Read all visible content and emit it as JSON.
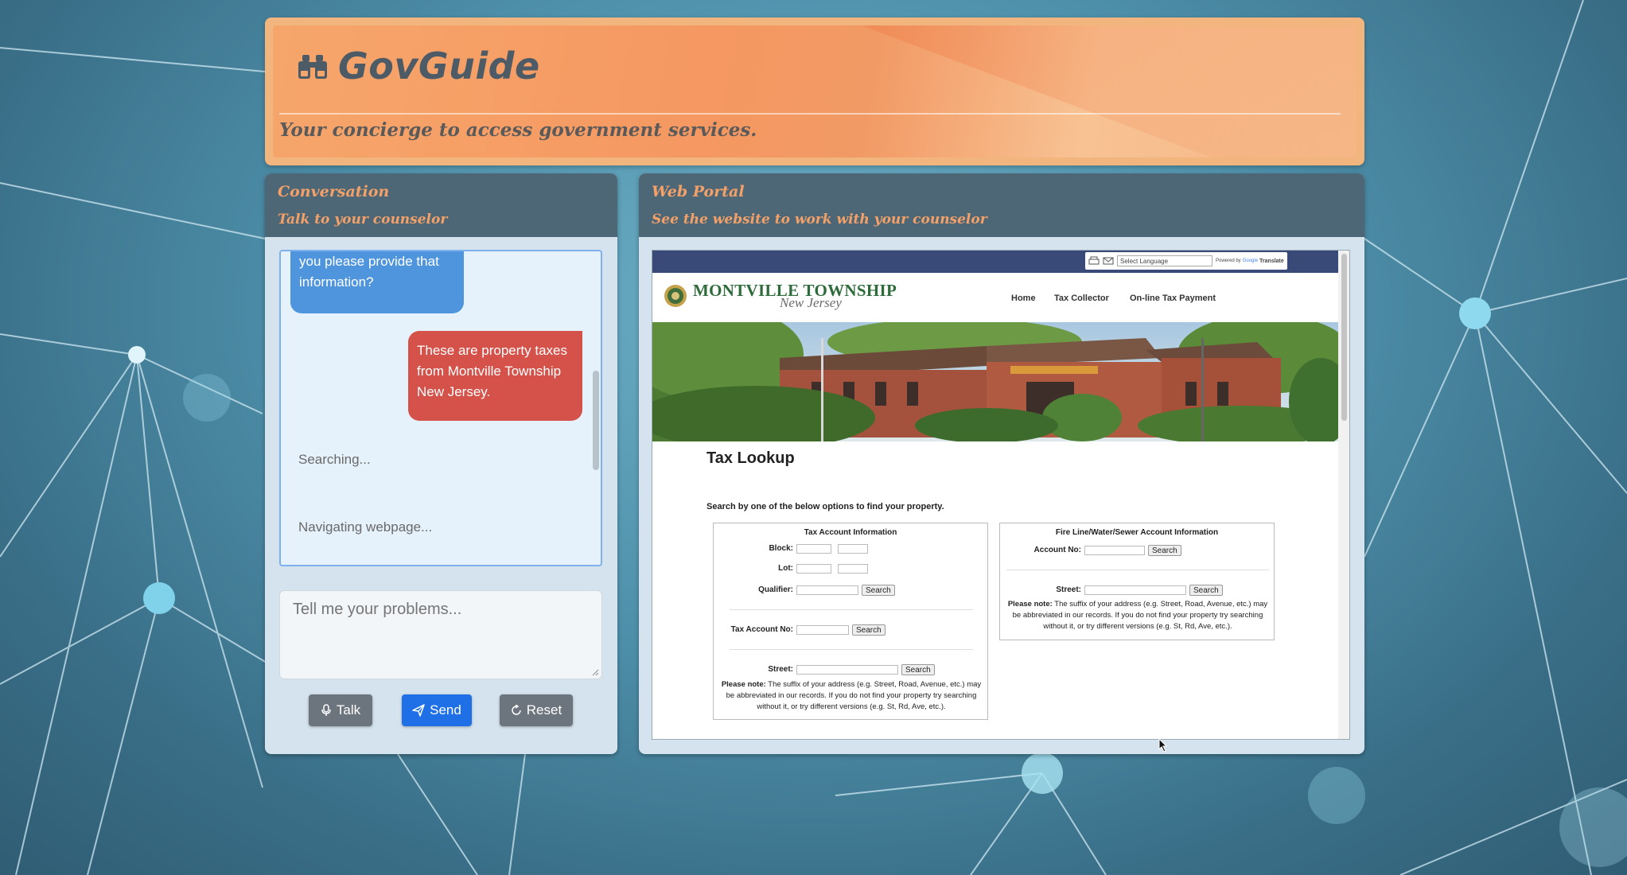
{
  "header": {
    "title": "GovGuide",
    "tagline": "Your concierge to access government services."
  },
  "conversation": {
    "title": "Conversation",
    "subtitle": "Talk to your counselor",
    "messages": [
      {
        "role": "bot",
        "text": "you please provide that information?"
      },
      {
        "role": "user",
        "text": "These are property taxes from Montville Township New Jersey."
      }
    ],
    "status": [
      "Searching...",
      "Navigating webpage..."
    ],
    "input_placeholder": "Tell me your problems...",
    "buttons": {
      "talk": "Talk",
      "send": "Send",
      "reset": "Reset"
    }
  },
  "web_portal": {
    "title": "Web Portal",
    "subtitle": "See the website to work with your counselor",
    "site": {
      "translate_select": "Select Language",
      "translate_powered": "Powered by",
      "translate_google": "Google",
      "translate_word": "Translate",
      "name": "MONTVILLE TOWNSHIP",
      "name_sub": "New Jersey",
      "nav": [
        "Home",
        "Tax Collector",
        "On-line Tax Payment"
      ],
      "page_title": "Tax Lookup",
      "instruction": "Search by one of the below options to find your property.",
      "tax_box": {
        "title": "Tax Account Information",
        "block_label": "Block:",
        "lot_label": "Lot:",
        "qualifier_label": "Qualifier:",
        "account_label": "Tax Account No:",
        "street_label": "Street:",
        "search": "Search",
        "note_bold": "Please note:",
        "note": "The suffix of your address (e.g. Street, Road, Avenue, etc.) may be abbreviated in our records. If you do not find your property try searching without it, or try different versions (e.g. St, Rd, Ave, etc.)."
      },
      "fire_box": {
        "title": "Fire Line/Water/Sewer Account Information",
        "account_label": "Account No:",
        "street_label": "Street:",
        "search": "Search",
        "note_bold": "Please note:",
        "note": "The suffix of your address (e.g. Street, Road, Avenue, etc.) may be abbreviated in our records. If you do not find your property try searching without it, or try different versions (e.g. St, Rd, Ave, etc.)."
      }
    }
  },
  "colors": {
    "accent_orange": "#f3a168",
    "panel_header": "#4e6776",
    "bot_bubble": "#4f95de",
    "user_bubble": "#d4524a",
    "send_button": "#1f6fe6"
  },
  "icons": [
    "binoculars-icon",
    "microphone-icon",
    "send-icon",
    "reset-icon",
    "mouse-cursor-icon"
  ]
}
